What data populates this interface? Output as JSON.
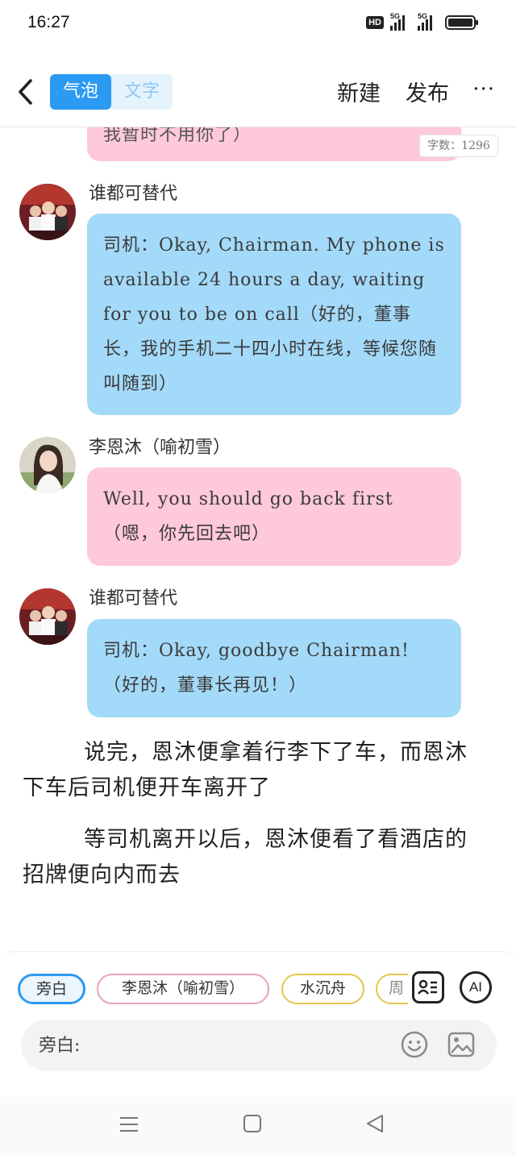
{
  "status_bar": {
    "time": "16:27",
    "hd_badge": "HD",
    "network_1": "5G",
    "network_2": "5G"
  },
  "header": {
    "tabs": [
      {
        "label": "气泡",
        "active": true
      },
      {
        "label": "文字",
        "active": false
      }
    ],
    "new_label": "新建",
    "publish_label": "发布",
    "more_label": "···"
  },
  "chat": {
    "partial_message": "我暂时不用你了）",
    "word_count": "字数：1296",
    "messages": [
      {
        "speaker": "谁都可替代",
        "text": "司机：Okay, Chairman. My phone is available 24 hours a day, waiting for you to be on call（好的，董事长，我的手机二十四小时在线，等候您随叫随到）",
        "color": "#a4daf9"
      },
      {
        "speaker": "李恩沐（喻初雪）",
        "text": "Well, you should go back first（嗯，你先回去吧）",
        "color": "#fec9d8"
      },
      {
        "speaker": "谁都可替代",
        "text": "司机：Okay, goodbye Chairman!（好的，董事长再见！）",
        "color": "#a4daf9"
      }
    ],
    "narration": [
      "说完，恩沐便拿着行李下了车，而恩沐下车后司机便开车离开了",
      "等司机离开以后，恩沐便看了看酒店的招牌便向内而去"
    ]
  },
  "composer": {
    "chips": [
      "旁白",
      "李恩沐（喻初雪）",
      "水沉舟",
      "周"
    ],
    "ai_label": "AI",
    "placeholder": "旁白:"
  }
}
